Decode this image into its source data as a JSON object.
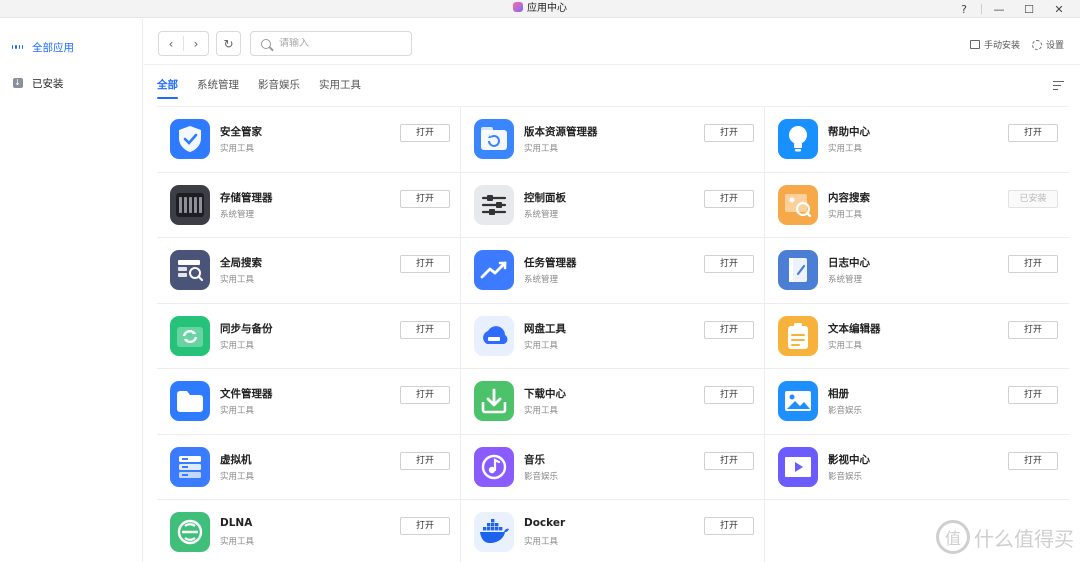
{
  "window": {
    "title": "应用中心",
    "controls": {
      "help": "?",
      "minimize": "—",
      "maximize": "☐",
      "close": "✕"
    }
  },
  "sidebar": {
    "items": [
      {
        "label": "全部应用",
        "icon": "grid-icon",
        "active": true
      },
      {
        "label": "已安装",
        "icon": "download-box-icon",
        "active": false
      }
    ]
  },
  "toolbar": {
    "back": "‹",
    "forward": "›",
    "refresh": "↻",
    "search_placeholder": "请输入",
    "manual_install": "手动安装",
    "settings": "设置"
  },
  "tabs": [
    {
      "label": "全部",
      "active": true
    },
    {
      "label": "系统管理",
      "active": false
    },
    {
      "label": "影音娱乐",
      "active": false
    },
    {
      "label": "实用工具",
      "active": false
    }
  ],
  "apps": [
    {
      "name": "安全管家",
      "category": "实用工具",
      "button": "打开",
      "enabled": true,
      "icon": "shield-icon",
      "color": "#2f7bff"
    },
    {
      "name": "版本资源管理器",
      "category": "实用工具",
      "button": "打开",
      "enabled": true,
      "icon": "folder-restore-icon",
      "color": "#3a86ff"
    },
    {
      "name": "帮助中心",
      "category": "实用工具",
      "button": "打开",
      "enabled": true,
      "icon": "lightbulb-icon",
      "color": "#1890ff"
    },
    {
      "name": "存储管理器",
      "category": "系统管理",
      "button": "打开",
      "enabled": true,
      "icon": "storage-drives-icon",
      "color": "#3b3f45"
    },
    {
      "name": "控制面板",
      "category": "系统管理",
      "button": "打开",
      "enabled": true,
      "icon": "sliders-icon",
      "color": "#e8e9ec"
    },
    {
      "name": "内容搜索",
      "category": "实用工具",
      "button": "已安装",
      "enabled": false,
      "icon": "image-search-icon",
      "color": "#f7a94a"
    },
    {
      "name": "全局搜索",
      "category": "实用工具",
      "button": "打开",
      "enabled": true,
      "icon": "global-search-icon",
      "color": "#4a5478"
    },
    {
      "name": "任务管理器",
      "category": "系统管理",
      "button": "打开",
      "enabled": true,
      "icon": "trend-chart-icon",
      "color": "#3c7bff"
    },
    {
      "name": "日志中心",
      "category": "系统管理",
      "button": "打开",
      "enabled": true,
      "icon": "log-notebook-icon",
      "color": "#4b7fd6"
    },
    {
      "name": "同步与备份",
      "category": "实用工具",
      "button": "打开",
      "enabled": true,
      "icon": "sync-folder-icon",
      "color": "#27c27a"
    },
    {
      "name": "网盘工具",
      "category": "实用工具",
      "button": "打开",
      "enabled": true,
      "icon": "cloud-disk-icon",
      "color": "#e8f0ff"
    },
    {
      "name": "文本编辑器",
      "category": "实用工具",
      "button": "打开",
      "enabled": true,
      "icon": "clipboard-text-icon",
      "color": "#f7b23b"
    },
    {
      "name": "文件管理器",
      "category": "实用工具",
      "button": "打开",
      "enabled": true,
      "icon": "folder-icon",
      "color": "#2f7bff"
    },
    {
      "name": "下载中心",
      "category": "实用工具",
      "button": "打开",
      "enabled": true,
      "icon": "download-tray-icon",
      "color": "#4cc26a"
    },
    {
      "name": "相册",
      "category": "影音娱乐",
      "button": "打开",
      "enabled": true,
      "icon": "photo-album-icon",
      "color": "#1e8fff"
    },
    {
      "name": "虚拟机",
      "category": "实用工具",
      "button": "打开",
      "enabled": true,
      "icon": "server-vm-icon",
      "color": "#3a7bff"
    },
    {
      "name": "音乐",
      "category": "影音娱乐",
      "button": "打开",
      "enabled": true,
      "icon": "music-note-icon",
      "color": "#8a5cff"
    },
    {
      "name": "影视中心",
      "category": "影音娱乐",
      "button": "打开",
      "enabled": true,
      "icon": "video-player-icon",
      "color": "#6a5cff"
    },
    {
      "name": "DLNA",
      "category": "实用工具",
      "button": "打开",
      "enabled": true,
      "icon": "dlna-icon",
      "color": "#3fbf7a"
    },
    {
      "name": "Docker",
      "category": "实用工具",
      "button": "打开",
      "enabled": true,
      "icon": "docker-whale-icon",
      "color": "#e9f1ff"
    }
  ],
  "watermark": {
    "glyph": "值",
    "text": "什么值得买"
  }
}
